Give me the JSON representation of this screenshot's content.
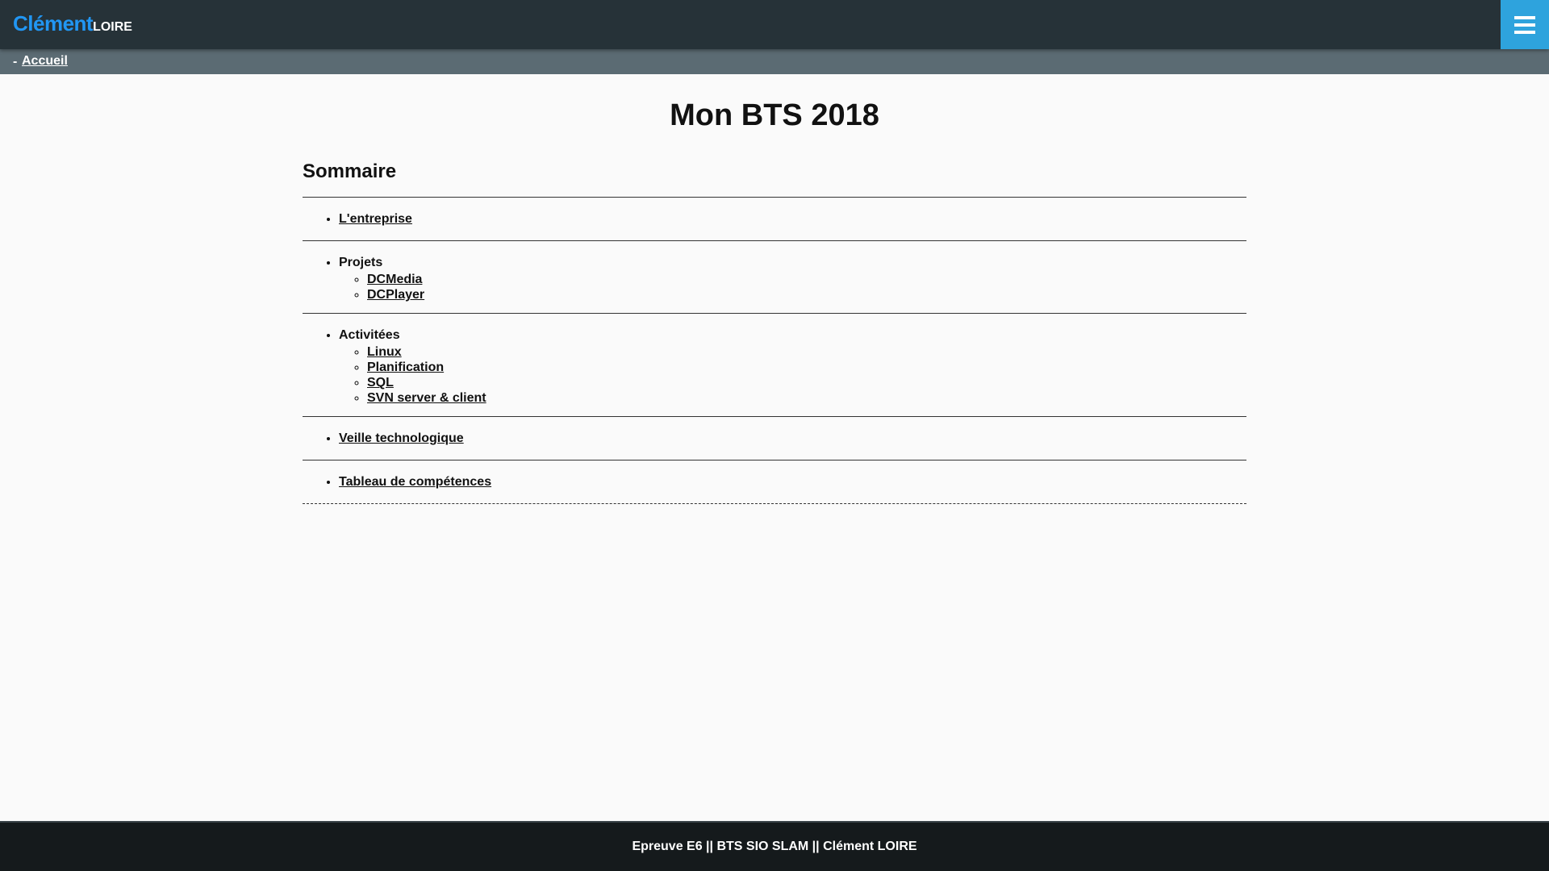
{
  "header": {
    "logo_first": "Clément",
    "logo_last": "LOIRE",
    "menu_icon": "hamburger-menu-icon"
  },
  "breadcrumb": {
    "separator": "-",
    "home": "Accueil"
  },
  "main": {
    "title": "Mon BTS 2018",
    "summary_heading": "Sommaire",
    "sections": [
      {
        "label": "L'entreprise"
      },
      {
        "label": "Projets",
        "items": [
          "DCMedia",
          "DCPlayer"
        ]
      },
      {
        "label": "Activitées",
        "items": [
          "Linux",
          "Planification",
          "SQL",
          "SVN server & client"
        ]
      },
      {
        "label": "Veille technologique"
      },
      {
        "label": "Tableau de compétences"
      }
    ]
  },
  "footer": {
    "text": "Epreuve E6 || BTS SIO SLAM || Clément LOIRE"
  },
  "colors": {
    "topbar": "#263238",
    "accent": "#2196f3",
    "menu_button": "#2ea3dd",
    "breadcrumb_bar": "#5b6b73",
    "footer": "#151a1c"
  }
}
